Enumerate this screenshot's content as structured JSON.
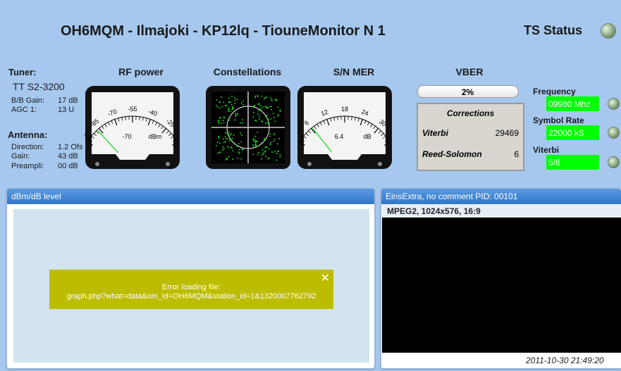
{
  "header": {
    "title": "OH6MQM - Ilmajoki - KP12lq - TiouneMonitor N 1",
    "ts_status": "TS Status"
  },
  "tuner": {
    "label": "Tuner:",
    "model": "TT S2-3200",
    "rows": [
      {
        "key": "B/B Gain:",
        "value": "17 dB"
      },
      {
        "key": "AGC 1:",
        "value": "13 U"
      }
    ]
  },
  "antenna": {
    "label": "Antenna:",
    "rows": [
      {
        "key": "Direction:",
        "value": "1.2 Ofs"
      },
      {
        "key": "Gain:",
        "value": "43 dB"
      },
      {
        "key": "Preampli:",
        "value": "00 dB"
      }
    ]
  },
  "gauges": {
    "rf_power": {
      "title": "RF power",
      "ticks": [
        "-100",
        "-85",
        "-70",
        "-55",
        "-40",
        "-25",
        "-10"
      ],
      "value": "-70",
      "unit": "dBm",
      "min": -100,
      "max": -10,
      "needle": -87
    },
    "constellations": {
      "title": "Constellations"
    },
    "sn_mer": {
      "title": "S/N MER",
      "ticks": [
        "0",
        "6",
        "12",
        "18",
        "24",
        "30",
        "36"
      ],
      "value": "6.4",
      "unit": "dB",
      "min": 0,
      "max": 36,
      "needle": 6.4
    }
  },
  "vber": {
    "title": "VBER",
    "percent_label": "2%",
    "fill": 0.02
  },
  "corrections": {
    "title": "Corrections",
    "rows": [
      {
        "key": "Viterbi",
        "value": "29469"
      },
      {
        "key": "Reed-Solomon",
        "value": "6"
      }
    ]
  },
  "status": {
    "frequency_label": "Frequency",
    "frequency_value": "09980 Mhz",
    "symbol_rate_label": "Symbol Rate",
    "symbol_rate_value": "22000 kS",
    "viterbi_label": "Viterbi",
    "viterbi_value": "5/6",
    "accent": "#00ff00"
  },
  "graph_panel": {
    "title": "dBm/dB level",
    "error_line1": "Error loading file:",
    "error_line2": "graph.php?what=data&om_id=OH6MQM&station_id=1&1320007762792",
    "close": "✕"
  },
  "video_panel": {
    "title": "EinsExtra, no comment PID: 00101",
    "format": "MPEG2, 1024x576, 16:9",
    "timestamp": "2011-10-30 21:49:20"
  }
}
